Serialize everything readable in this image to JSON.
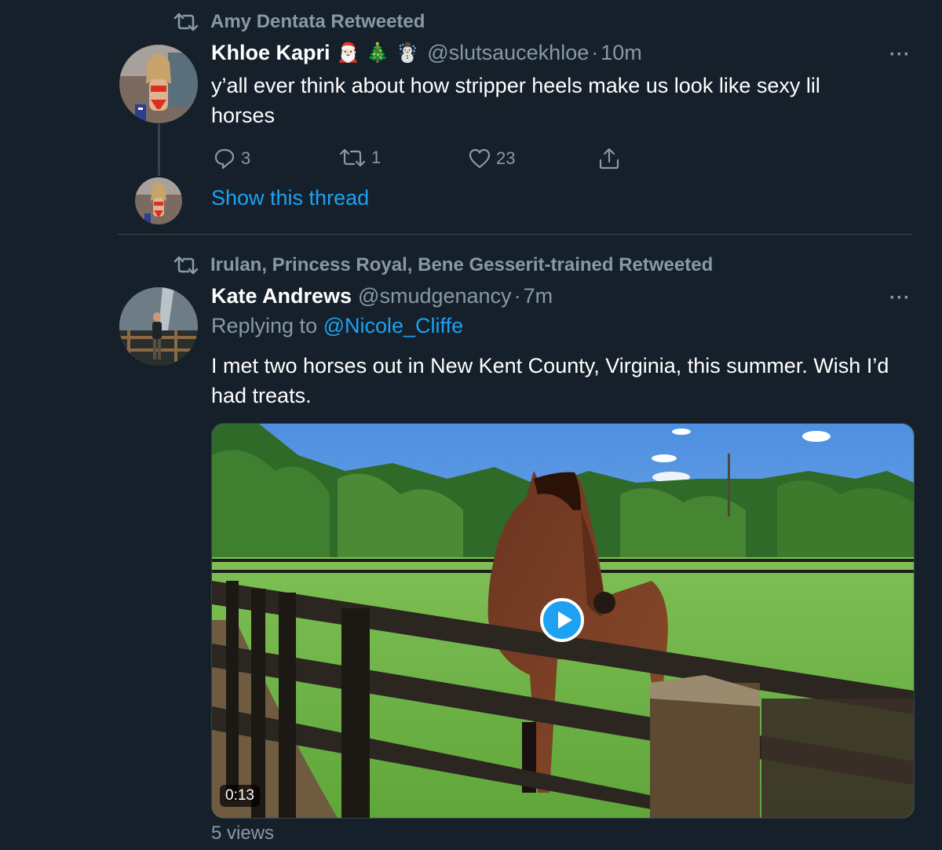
{
  "tweet1": {
    "retweeted_by": "Amy Dentata Retweeted",
    "name": "Khloe Kapri",
    "emojis": [
      "🎅🏻",
      "🎄",
      "☃️"
    ],
    "handle": "@slutsaucekhloe",
    "separator": "·",
    "time": "10m",
    "more": "···",
    "text": "y’all ever think about how stripper heels make us look like sexy lil horses",
    "replies": "3",
    "retweets": "1",
    "likes": "23",
    "show_thread": "Show this thread"
  },
  "tweet2": {
    "retweeted_by": "Irulan, Princess Royal, Bene Gesserit-trained Retweeted",
    "name": "Kate Andrews",
    "handle": "@smudgenancy",
    "separator": "·",
    "time": "7m",
    "more": "···",
    "replying_prefix": "Replying to",
    "replying_to": "@Nicole_Cliffe",
    "text": "I met two horses out in New Kent County, Virginia, this summer. Wish I’d had treats.",
    "video_duration": "0:13",
    "views": "5 views"
  },
  "icons": {
    "retweet": "retweet-icon",
    "reply": "reply-icon",
    "like": "heart-icon",
    "share": "share-icon",
    "more": "more-icon",
    "play": "play-icon"
  },
  "colors": {
    "background": "#15202b",
    "secondary_text": "#8899a6",
    "accent": "#1da1f2",
    "divider": "#38444d"
  }
}
